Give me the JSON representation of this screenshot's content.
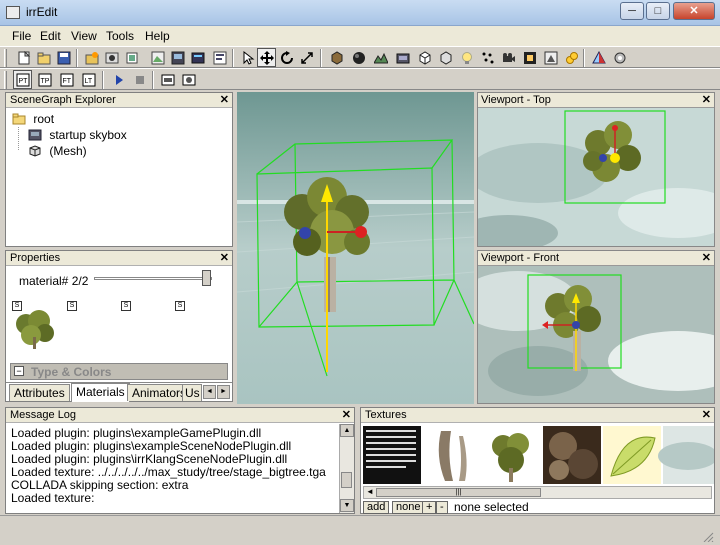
{
  "window": {
    "title": "irrEdit",
    "controls": {
      "minimize": "─",
      "maximize": "□",
      "close": "✕"
    }
  },
  "menu": [
    "File",
    "Edit",
    "View",
    "Tools",
    "Help"
  ],
  "toolbar2": {
    "buttons": [
      "PT",
      "TP",
      "FT",
      "LT"
    ]
  },
  "scenegraph": {
    "title": "SceneGraph Explorer",
    "items": [
      {
        "label": "root",
        "icon": "folder-icon"
      },
      {
        "label": "startup skybox",
        "icon": "skybox-icon"
      },
      {
        "label": "(Mesh)",
        "icon": "mesh-icon"
      }
    ]
  },
  "properties": {
    "title": "Properties",
    "material_label": "material# 2/2",
    "s_buttons": [
      "S",
      "S",
      "S",
      "S"
    ],
    "section_label": "Type & Colors",
    "tabs": [
      "Attributes",
      "Materials",
      "Animators",
      "Us"
    ],
    "active_tab": "Materials"
  },
  "viewports": {
    "top": "Viewport - Top",
    "front": "Viewport - Front"
  },
  "message_log": {
    "title": "Message Log",
    "lines": [
      "Loaded plugin: plugins\\exampleGamePlugin.dll",
      "Loaded plugin: plugins\\exampleSceneNodePlugin.dll",
      "Loaded plugin: plugins\\irrKlangSceneNodePlugin.dll",
      "Loaded texture: ../../../../../max_study/tree/stage_bigtree.tga",
      "COLLADA skipping section: extra",
      "Loaded texture:"
    ]
  },
  "textures": {
    "title": "Textures",
    "add_label": "add",
    "none_label": "none",
    "plus_label": "+",
    "minus_label": "-",
    "status": "none selected",
    "scroll_grip": "|||"
  },
  "colors": {
    "title_bar": "#b8cfec",
    "panel_bg": "#ffffff",
    "viewport_sky": "#9fbcb6",
    "selection_box": "#22dd22"
  }
}
